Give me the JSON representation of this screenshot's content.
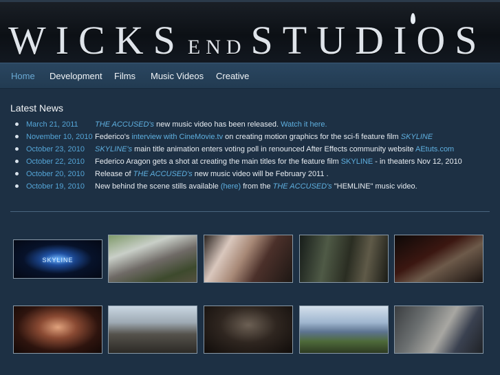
{
  "header": {
    "logo_part1": "WICKS",
    "logo_part2": "END",
    "logo_part3": "STUDIOS"
  },
  "nav": {
    "items": [
      {
        "label": "Home",
        "active": true
      },
      {
        "label": "Development",
        "active": false
      },
      {
        "label": "Films",
        "active": false
      },
      {
        "label": "Music Videos",
        "active": false
      },
      {
        "label": "Creative",
        "active": false
      }
    ]
  },
  "news": {
    "title": "Latest News",
    "items": [
      {
        "date": "March 21, 2011",
        "segments": [
          {
            "t": "THE ACCUSED's",
            "s": "it"
          },
          {
            "t": " new music video has been released. ",
            "s": ""
          },
          {
            "t": "Watch it here.",
            "s": "hl"
          }
        ]
      },
      {
        "date": "November 10, 2010",
        "segments": [
          {
            "t": "Federico's ",
            "s": ""
          },
          {
            "t": "interview with CineMovie.tv",
            "s": "hl"
          },
          {
            "t": " on creating motion graphics for the sci-fi feature film ",
            "s": ""
          },
          {
            "t": "SKYLINE",
            "s": "it"
          }
        ]
      },
      {
        "date": "October 23, 2010",
        "segments": [
          {
            "t": "SKYLINE's",
            "s": "it"
          },
          {
            "t": " main title animation enters voting poll in renounced After Effects community website ",
            "s": ""
          },
          {
            "t": "AEtuts.com",
            "s": "hl"
          }
        ]
      },
      {
        "date": "October 22, 2010",
        "segments": [
          {
            "t": "Federico Aragon gets a shot at creating the main titles for the feature film ",
            "s": ""
          },
          {
            "t": "SKYLINE",
            "s": "hl"
          },
          {
            "t": " - in theaters Nov 12, 2010",
            "s": ""
          }
        ]
      },
      {
        "date": "October 20, 2010",
        "segments": [
          {
            "t": "Release of ",
            "s": ""
          },
          {
            "t": "THE ACCUSED's",
            "s": "it"
          },
          {
            "t": " new music video will be February 2011 .",
            "s": ""
          }
        ]
      },
      {
        "date": "October 19, 2010",
        "segments": [
          {
            "t": "New behind the scene stills available ",
            "s": ""
          },
          {
            "t": "(here)",
            "s": "hl"
          },
          {
            "t": " from the ",
            "s": ""
          },
          {
            "t": "THE ACCUSED's",
            "s": "it"
          },
          {
            "t": " \"HEMLINE\" music video.",
            "s": ""
          }
        ]
      }
    ]
  },
  "gallery": {
    "thumbs": [
      {
        "name": "skyline-title-thumb",
        "caption": "SKYLINE",
        "bg": "radial-gradient(ellipse at 50% 50%, #6fb4ff 0%, #1f4fa0 22%, #07122a 55%, #040814 100%)"
      },
      {
        "name": "film-crew-outdoor-thumb",
        "caption": "",
        "bg": "linear-gradient(160deg, #7f9a6a 0%, #c9cfc8 30%, #6f6a66 55%, #3d4a2d 80%, #55503f 100%)"
      },
      {
        "name": "makeup-session-thumb",
        "caption": "",
        "bg": "linear-gradient(120deg, #2a2320 0%, #d9c7bd 25%, #a78876 45%, #4b302a 65%, #1d1714 100%)"
      },
      {
        "name": "dark-car-scene-thumb",
        "caption": "",
        "bg": "linear-gradient(100deg, #171d1a 0%, #4f5a46 30%, #2a2d22 55%, #5f5a48 75%, #1b1c16 100%)"
      },
      {
        "name": "night-driver-thumb",
        "caption": "",
        "bg": "linear-gradient(150deg, #0d0908 0%, #3b1711 40%, #6d5a4a 60%, #1a1310 100%)"
      },
      {
        "name": "woman-portrait-thumb",
        "caption": "",
        "bg": "radial-gradient(ellipse at 50% 45%, #e0a27d 0%, #8a4a33 30%, #2e140e 65%, #120806 100%)"
      },
      {
        "name": "palm-street-drive-thumb",
        "caption": "",
        "bg": "linear-gradient(180deg, #c9d6e2 0%, #9eaab3 35%, #55524c 60%, #2c2a26 100%)"
      },
      {
        "name": "dark-hat-man-thumb",
        "caption": "",
        "bg": "radial-gradient(ellipse at 50% 40%, #6c6054 0%, #2f2620 45%, #100c0a 100%)"
      },
      {
        "name": "ocean-cliff-couple-thumb",
        "caption": "",
        "bg": "linear-gradient(180deg, #d4e0ec 0%, #9fb6cf 35%, #5d7490 55%, #4e6a3a 75%, #2d3a22 100%)"
      },
      {
        "name": "camera-crew-thumb",
        "caption": "",
        "bg": "linear-gradient(120deg, #3a3d40 0%, #6b6f70 30%, #a8a7a2 55%, #3a4150 75%, #1f2226 100%)"
      }
    ]
  }
}
